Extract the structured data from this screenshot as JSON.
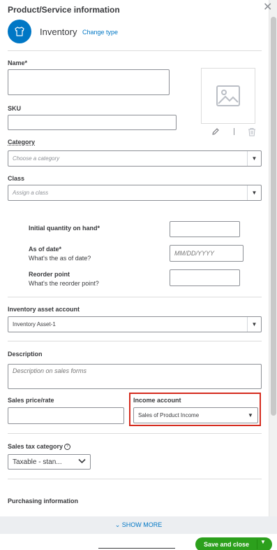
{
  "panel": {
    "title": "Product/Service information",
    "close_glyph": "✕"
  },
  "item_type": {
    "name": "Inventory",
    "change_label": "Change type",
    "icon": "tshirt-icon",
    "accent_color": "#0077c5"
  },
  "fields": {
    "name_label": "Name*",
    "name_value": "",
    "sku_label": "SKU",
    "sku_value": "",
    "category_label": "Category",
    "category_placeholder": "Choose a category",
    "class_label": "Class",
    "class_placeholder": "Assign a class",
    "initial_qty_label": "Initial quantity on hand*",
    "initial_qty_value": "",
    "as_of_label": "As of date*",
    "as_of_help": "What's the as of date?",
    "as_of_placeholder": "MM/DD/YYYY",
    "reorder_label": "Reorder point",
    "reorder_help": "What's the reorder point?",
    "inventory_asset_label": "Inventory asset account",
    "inventory_asset_value": "Inventory Asset-1",
    "description_label": "Description",
    "description_placeholder": "Description on sales forms",
    "sales_price_label": "Sales price/rate",
    "income_account_label": "Income account",
    "income_account_value": "Sales of Product Income",
    "sales_tax_label": "Sales tax category",
    "sales_tax_value": "Taxable - stan...",
    "purchasing_label": "Purchasing information"
  },
  "footer": {
    "show_more_label": "⌄ SHOW MORE",
    "save_label": "Save and close",
    "save_color": "#2ca01c"
  },
  "highlight_color": "#d52b1e"
}
